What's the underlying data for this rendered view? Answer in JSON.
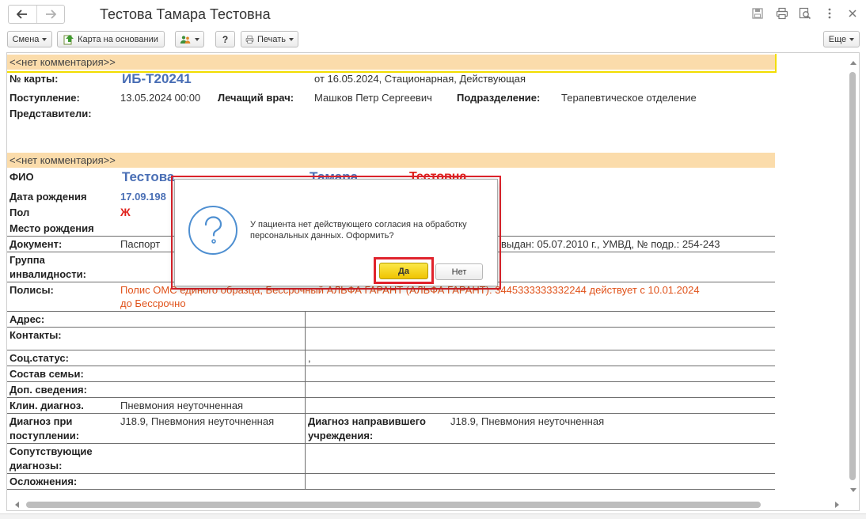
{
  "window": {
    "title": "Тестова Тамара Тестовна",
    "icons": [
      "back-arrow-icon",
      "forward-arrow-icon",
      "save-icon",
      "print-icon",
      "preview-icon",
      "more-vertical-icon",
      "close-icon"
    ]
  },
  "toolbar": {
    "change_label": "Смена",
    "card_basis_label": "Карта на основании",
    "help_label": "?",
    "print_label": "Печать",
    "more_label": "Еще"
  },
  "doc": {
    "comment_top": "<<нет комментария>>",
    "card_no_label": "№ карты:",
    "card_no_value": "ИБ-Т20241",
    "card_info": "от 16.05.2024, Стационарная, Действующая",
    "admission_label": "Поступление:",
    "admission_value": "13.05.2024 00:00",
    "doctor_label": "Лечащий врач:",
    "doctor_value": "Машков Петр Сергеевич",
    "dept_label": "Подразделение:",
    "dept_value": "Терапевтическое отделение",
    "reps_label": "Представители:",
    "comment_second": "<<нет комментария>>",
    "fio_label": "ФИО",
    "fio_surname": "Тестова",
    "fio_name": "Тамара",
    "fio_patronymic": "Тестовна",
    "birth_label": "Дата рождения",
    "birth_value": "17.09.198",
    "sex_label": "Пол",
    "sex_value": "Ж",
    "birthplace_label": "Место рождения",
    "document_label": "Документ:",
    "document_value": "Паспорт",
    "document_tail": "выдан: 05.07.2010 г., УМВД, № подр.: 254-243",
    "disability_label_1": "Группа",
    "disability_label_2": "инвалидности:",
    "policies_label": "Полисы:",
    "policies_value_1": "Полис ОМС единого образца, Бессрочный АЛЬФА ГАРАНТ (АЛЬФА ГАРАНТ): 3445333333332244 действует с 10.01.2024",
    "policies_value_2": "до Бессрочно",
    "address_label": "Адрес:",
    "contacts_label": "Контакты:",
    "social_label": "Соц.статус:",
    "social_value": ",",
    "family_label": "Состав семьи:",
    "extra_label": "Доп. сведения:",
    "clin_diag_label": "Клин. диагноз.",
    "clin_diag_value": "Пневмония неуточненная",
    "adm_diag_label_1": "Диагноз при",
    "adm_diag_label_2": "поступлении:",
    "adm_diag_value": "J18.9, Пневмония неуточненная",
    "ref_diag_label_1": "Диагноз направившего",
    "ref_diag_label_2": "учреждения:",
    "ref_diag_value": "J18.9, Пневмония неуточненная",
    "comorb_label_1": "Сопутствующие",
    "comorb_label_2": "диагнозы:",
    "compl_label": "Осложнения:"
  },
  "dialog": {
    "icon": "question-circle-icon",
    "message_1": "У пациента нет действующего согласия на обработку",
    "message_2": "персональных данных. Оформить?",
    "yes_label": "Да",
    "no_label": "Нет"
  },
  "colors": {
    "comment_bg": "#fbdcab",
    "accent_blue": "#4a6fb5",
    "accent_red": "#e0221c",
    "policy_orange": "#e0521a",
    "highlight_outline": "#e0232c",
    "default_button_yellow": "#f6d300"
  }
}
